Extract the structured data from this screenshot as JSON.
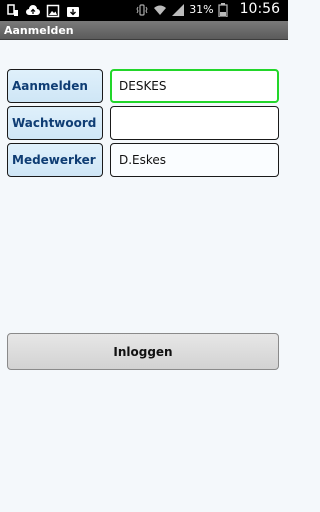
{
  "statusbar": {
    "battery_percent": "31%",
    "time": "10:56",
    "icons_left": [
      "usb-icon",
      "cloud-upload-icon",
      "image-icon",
      "download-icon"
    ],
    "icons_right": [
      "vibrate-icon",
      "wifi-icon",
      "signal-icon",
      "battery-icon"
    ]
  },
  "titlebar": {
    "title": "Aanmelden"
  },
  "form": {
    "rows": [
      {
        "label": "Aanmelden",
        "value": "DESKES"
      },
      {
        "label": "Wachtwoord",
        "value": ""
      },
      {
        "label": "Medewerker",
        "value": "D.Eskes"
      }
    ]
  },
  "actions": {
    "login_label": "Inloggen"
  },
  "colors": {
    "label_text": "#0f3d74",
    "focus_border": "#22d62a",
    "titlebar_bg": "#6b6b6b"
  }
}
